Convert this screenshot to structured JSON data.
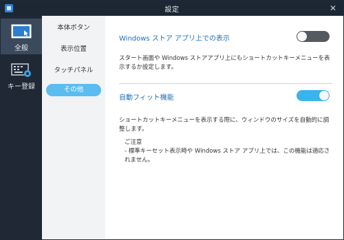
{
  "window": {
    "title": "設定",
    "close_glyph": "✕"
  },
  "left_rail": {
    "items": [
      {
        "label": "全般",
        "icon": "monitor-pointer-icon",
        "active": true
      },
      {
        "label": "キー登録",
        "icon": "keyboard-gear-icon",
        "active": false
      }
    ]
  },
  "sub_nav": {
    "items": [
      {
        "label": "本体ボタン",
        "active": false
      },
      {
        "label": "表示位置",
        "active": false
      },
      {
        "label": "タッチパネル",
        "active": false
      },
      {
        "label": "その他",
        "active": true
      }
    ]
  },
  "settings": {
    "store_app": {
      "title": "Windows ストア アプリ上での表示",
      "description": "スタート画面や Windows ストアアプリ上にもショートカットキーメニューを表示するか設定します。",
      "toggle_state": "off"
    },
    "auto_fit": {
      "title": "自動フィット機能",
      "description": "ショートカットキーメニューを表示する際に、ウィンドウのサイズを自動的に調整します。",
      "toggle_state": "on",
      "note_heading": "ご注意",
      "note_body": "- 標準キーセット表示時や Windows ストア アプリ上では、この機能は適応されません。"
    }
  },
  "colors": {
    "titlebar": "#1c2733",
    "rail": "#1f2834",
    "rail_active": "#3a4a5c",
    "accent": "#39b4ee",
    "section_title": "#1e6fb5",
    "toggle_off": "#555a60"
  }
}
